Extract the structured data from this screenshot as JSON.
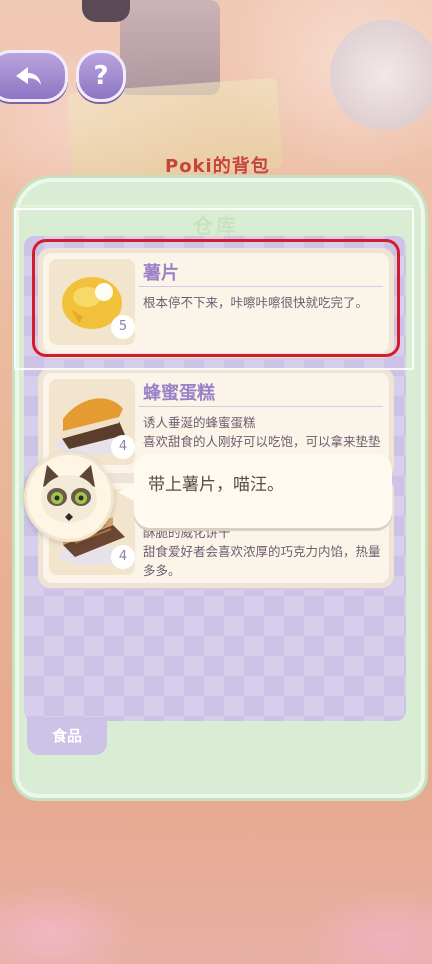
{
  "header": {
    "bag_title": "Poki的背包",
    "share_icon": "share-icon",
    "help_label": "?"
  },
  "panel": {
    "title": "仓库",
    "tab_label": "食品"
  },
  "items": [
    {
      "name": "薯片",
      "desc": "根本停不下来，咔嚓咔嚓很快就吃完了。",
      "qty": "5",
      "icon": "chips-icon"
    },
    {
      "name": "蜂蜜蛋糕",
      "desc": "诱人垂涎的蜂蜜蛋糕\n喜欢甜食的人刚好可以吃饱，可以拿来垫垫肚子。",
      "qty": "4",
      "icon": "honey-cake-icon"
    },
    {
      "name": "",
      "desc": "酥脆的威化饼干\n甜食爱好者会喜欢浓厚的巧克力内馅，热量多多。",
      "qty": "4",
      "icon": "wafer-icon"
    }
  ],
  "dialog": {
    "text": "带上薯片，喵汪。",
    "speaker_icon": "cat-avatar-icon"
  },
  "colors": {
    "highlight": "#d21e2a",
    "item_name": "#9c83c8"
  }
}
